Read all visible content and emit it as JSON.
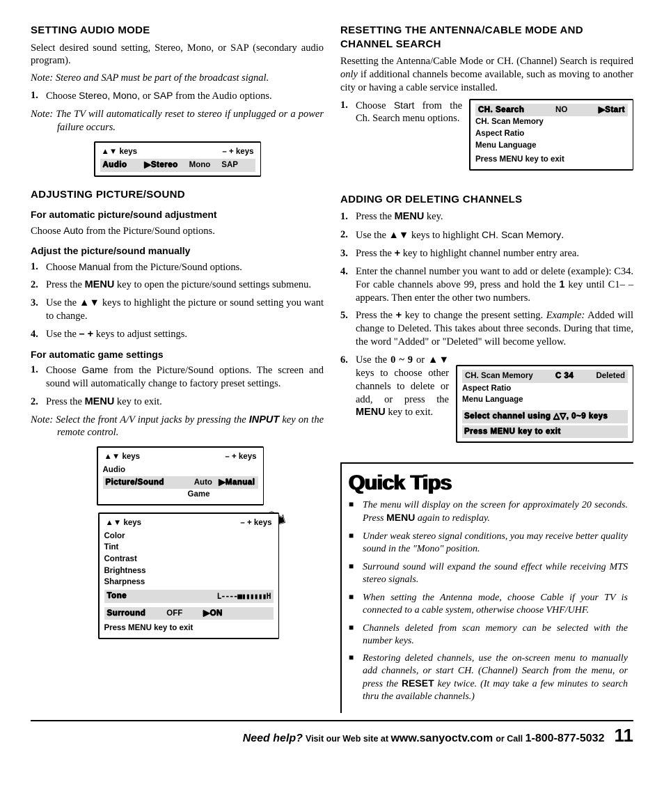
{
  "left": {
    "s1": {
      "heading": "SETTING AUDIO MODE",
      "p1a": "Select desired sound setting, Stereo, Mono, or SAP (secondary audio program).",
      "note1": "Note: Stereo and SAP must be part of the broadcast signal.",
      "step1_pre": "Choose ",
      "step1_opts": "Stereo, Mono,",
      "step1_or": " or ",
      "step1_sap": "SAP",
      "step1_post": " from the Audio options.",
      "note2": "Note: The TV will automatically reset to stereo if unplugged or a power failure occurs.",
      "osd": {
        "hdr_left": "▲▼ keys",
        "hdr_right": "– + keys",
        "row_audio": "Audio",
        "arrow_stereo": "▶Stereo",
        "mono": "Mono",
        "sap": "SAP"
      }
    },
    "s2": {
      "heading": "ADJUSTING PICTURE/SOUND",
      "sub1": "For automatic picture/sound adjustment",
      "p_auto_pre": "Choose ",
      "p_auto_lab": "Auto",
      "p_auto_post": " from the Picture/Sound options.",
      "sub2": "Adjust the picture/sound manually",
      "m1_pre": "Choose ",
      "m1_lab": "Manual",
      "m1_post": " from the Picture/Sound options.",
      "m2_a": "Press the ",
      "m2_menu": "MENU",
      "m2_b": " key to open the picture/sound settings submenu.",
      "m3": "Use the ▲▼ keys to highlight the picture or sound setting you want to change.",
      "m4_a": "Use the ",
      "m4_keys": "– +",
      "m4_b": " keys to adjust settings.",
      "sub3": "For automatic game settings",
      "g1_pre": "Choose ",
      "g1_lab": "Game",
      "g1_post": " from the Picture/Sound options. The screen and sound will automatically change to factory preset settings.",
      "g2_a": "Press the ",
      "g2_menu": "MENU",
      "g2_b": " key to exit.",
      "note3a": "Note: Select the front A/V input jacks by pressing the ",
      "note3b": "INPUT",
      "note3c": " key on the remote control.",
      "osdA": {
        "hdr_left": "▲▼ keys",
        "hdr_right": "– + keys",
        "audio": "Audio",
        "ps": "Picture/Sound",
        "auto": "Auto",
        "manual": "▶Manual",
        "game": "Game"
      },
      "osdB": {
        "hdr_left": "▲▼ keys",
        "hdr_right": "– + keys",
        "color": "Color",
        "tint": "Tint",
        "contrast": "Contrast",
        "brightness": "Brightness",
        "sharpness": "Sharpness",
        "tone": "Tone",
        "slider": "L----■▮▮▮▮▮▮H",
        "surround": "Surround",
        "off": "OFF",
        "on": "▶ON",
        "exit": "Press MENU key to exit"
      }
    }
  },
  "right": {
    "s1": {
      "heading": "RESETTING THE ANTENNA/CABLE MODE AND CHANNEL SEARCH",
      "p1_a": "Resetting the Antenna/Cable Mode or CH. (Channel) Search is required ",
      "p1_only": "only",
      "p1_b": " if additional channels become available, such as moving to another city or having a cable service installed.",
      "step1_a": "Choose ",
      "step1_lab": "Start",
      "step1_b": " from the Ch. Search menu options.",
      "osd": {
        "row1_a": "CH. Search",
        "row1_no": "NO",
        "row1_start": "▶Start",
        "r2": "CH. Scan Memory",
        "r3": "Aspect Ratio",
        "r4": "Menu Language",
        "exit": "Press MENU key to exit"
      }
    },
    "s2": {
      "heading": "ADDING OR DELETING CHANNELS",
      "a1_a": "Press the ",
      "a1_menu": "MENU",
      "a1_b": " key.",
      "a2_a": "Use the ▲▼ keys to highlight ",
      "a2_lab": "CH. Scan Memory",
      "a2_b": ".",
      "a3_a": "Press the ",
      "a3_plus": "+",
      "a3_b": " key to highlight channel number entry area.",
      "a4_a": "Enter the channel number you want to add or delete (example):  C34. For cable channels above 99, press and hold the ",
      "a4_one": "1",
      "a4_b": " key until C1– – appears. Then enter the other two numbers.",
      "a5_a": "Press the ",
      "a5_plus": "+",
      "a5_b": " key to change the present setting.  ",
      "a5_ex": "Example:",
      "a5_c": " Added will change to Deleted. This takes about three seconds. During that time, the word \"Added\" or \"Deleted\" will become yellow.",
      "a6_a": "Use the ",
      "a6_keys": "0 ~ 9",
      "a6_b": " or ▲▼ keys to choose other channels to delete or add, or press the ",
      "a6_menu": "MENU",
      "a6_c": " key to exit.",
      "osd": {
        "r1a": "CH. Scan Memory",
        "r1b": "C 34",
        "r1c": "Deleted",
        "r2": "Aspect Ratio",
        "r3": "Menu Language",
        "line1": "Select channel using △▽, 0~9 keys",
        "line2": "Press MENU key to exit"
      }
    },
    "tips": {
      "title": "Quick Tips",
      "t1a": "The menu will display on the screen for approximately 20 seconds. Press ",
      "t1m": "MENU",
      "t1b": " again to redisplay.",
      "t2": "Under weak stereo signal conditions, you may receive better quality sound in the \"Mono\" position.",
      "t3": "Surround sound will expand the sound effect while receiving MTS stereo signals.",
      "t4": "When setting the Antenna mode, choose Cable if your TV is connected to a cable system, otherwise choose VHF/UHF.",
      "t5": "Channels deleted from scan memory can be selected with the number keys.",
      "t6a": "Restoring deleted channels, use the on-screen menu to manually add channels, or start CH. (Channel) Search from the menu, or press the ",
      "t6r": "RESET",
      "t6b": " key twice. (It may take a few minutes to search thru the available channels.)"
    }
  },
  "footer": {
    "need": "Need help?",
    "visit": " Visit our Web site at ",
    "url": "www.sanyoctv.com",
    "call": " or Call ",
    "phone": "1-800-877-5032",
    "page": "11"
  }
}
